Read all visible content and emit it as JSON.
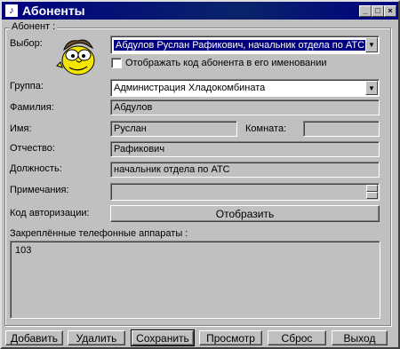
{
  "window": {
    "title": "Абоненты",
    "app_icon": "note-icon"
  },
  "titlebar_buttons": {
    "minimize": "_",
    "maximize": "□",
    "close": "×"
  },
  "group": {
    "label": "Абонент :"
  },
  "labels": {
    "choice": "Выбор:",
    "group": "Группа:",
    "surname": "Фамилия:",
    "name": "Имя:",
    "room": "Комната:",
    "patronymic": "Отчество:",
    "position": "Должность:",
    "notes": "Примечания:",
    "auth_code": "Код авторизации:",
    "phones": "Закреплённые телефонные аппараты :"
  },
  "form": {
    "choice_value": "Абдулов Руслан Рафикович, начальник отдела по АТС",
    "show_code_checkbox": {
      "label": "Отображать код абонента в его именовании",
      "checked": false
    },
    "group_value": "Администрация Хладокомбината",
    "surname": "Абдулов",
    "name": "Руслан",
    "room": "",
    "patronymic": "Рафикович",
    "position": "начальник отдела по АТС",
    "notes": "",
    "show_auth_button": "Отобразить",
    "phones": "103"
  },
  "buttons": {
    "add": "Добавить",
    "delete": "Удалить",
    "save": "Сохранить",
    "view": "Просмотр",
    "reset": "Сброс",
    "exit": "Выход"
  }
}
